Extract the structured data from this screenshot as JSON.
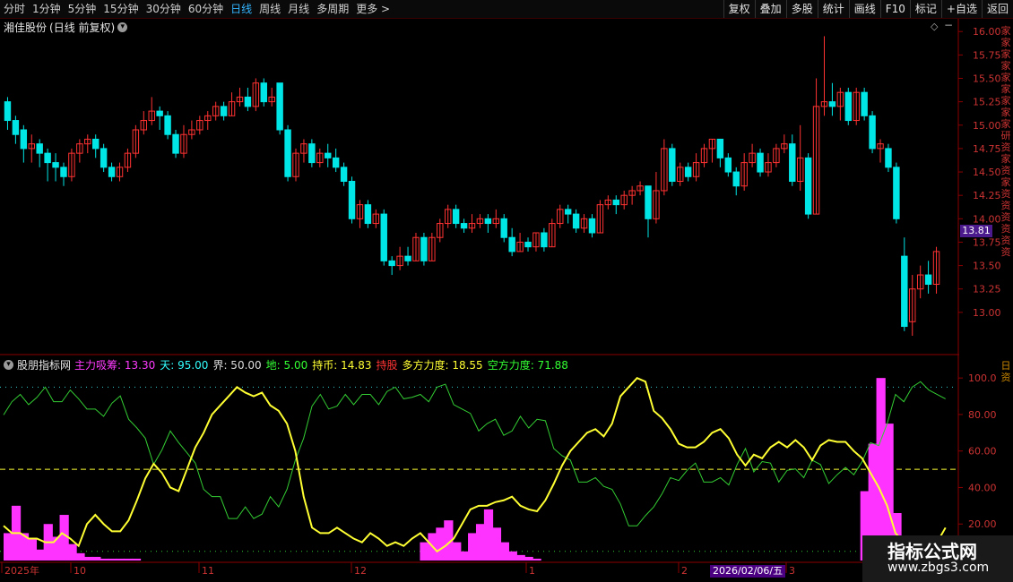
{
  "toolbar": {
    "periods": [
      "分时",
      "1分钟",
      "5分钟",
      "15分钟",
      "30分钟",
      "60分钟",
      "日线",
      "周线",
      "月线",
      "多周期",
      "更多"
    ],
    "active": "日线",
    "more_arrow": ">",
    "actions": [
      "复权",
      "叠加",
      "多股",
      "统计",
      "画线",
      "F10",
      "标记",
      "+自选",
      "返回"
    ]
  },
  "stock": {
    "name": "湘佳股份",
    "mode": "(日线 前复权)"
  },
  "price_axis": {
    "ticks": [
      "16.00",
      "15.75",
      "15.50",
      "15.25",
      "15.00",
      "14.75",
      "14.50",
      "14.25",
      "14.00",
      "13.75",
      "13.50",
      "13.25",
      "13.00"
    ],
    "current": "13.81"
  },
  "indicator": {
    "name": "股朋指标网",
    "items": [
      {
        "label": "主力吸筹:",
        "value": "13.30",
        "color": "#ff3bff"
      },
      {
        "label": "天:",
        "value": "95.00",
        "color": "#33ffff"
      },
      {
        "label": "界:",
        "value": "50.00",
        "color": "#dddddd"
      },
      {
        "label": "地:",
        "value": "5.00",
        "color": "#33ff33"
      },
      {
        "label": "持币:",
        "value": "14.83",
        "color": "#ffff33"
      },
      {
        "label": "持股",
        "value": "",
        "color": "#ff3333"
      },
      {
        "label": "多方力度:",
        "value": "18.55",
        "color": "#ffff33"
      },
      {
        "label": "空方力度:",
        "value": "71.88",
        "color": "#33ff33"
      }
    ],
    "axis_ticks": [
      "100.0",
      "80.00",
      "60.00",
      "40.00",
      "20.00"
    ]
  },
  "time_axis": {
    "labels": [
      "2025年",
      "10",
      "11",
      "12",
      "1",
      "2",
      "3"
    ],
    "cursor_date": "2026/02/06/五"
  },
  "right_side_chars": {
    "top": "家家家家家家家家家研资家资家资资资资资资",
    "bottom": "日资"
  },
  "watermark": {
    "title": "指标公式网",
    "url": "www.zbgs3.com"
  },
  "colors": {
    "up": "#ff3232",
    "down": "#00e5e5",
    "yellow": "#ffff33",
    "green": "#33cc33",
    "magenta": "#ff33ff",
    "border": "#8b0000"
  },
  "chart_data": {
    "type": "candlestick",
    "candles": [
      [
        15.25,
        15.05,
        15.3,
        14.95
      ],
      [
        15.05,
        14.9,
        15.1,
        14.8
      ],
      [
        14.95,
        14.75,
        15.0,
        14.6
      ],
      [
        14.75,
        14.8,
        14.9,
        14.6
      ],
      [
        14.8,
        14.7,
        14.85,
        14.55
      ],
      [
        14.7,
        14.6,
        14.75,
        14.4
      ],
      [
        14.6,
        14.55,
        14.7,
        14.4
      ],
      [
        14.55,
        14.45,
        14.6,
        14.35
      ],
      [
        14.45,
        14.7,
        14.75,
        14.4
      ],
      [
        14.7,
        14.8,
        14.85,
        14.6
      ],
      [
        14.8,
        14.85,
        14.9,
        14.7
      ],
      [
        14.85,
        14.75,
        14.9,
        14.65
      ],
      [
        14.75,
        14.55,
        14.8,
        14.5
      ],
      [
        14.55,
        14.45,
        14.6,
        14.4
      ],
      [
        14.45,
        14.55,
        14.6,
        14.4
      ],
      [
        14.55,
        14.7,
        14.75,
        14.5
      ],
      [
        14.7,
        14.95,
        15.0,
        14.65
      ],
      [
        14.95,
        15.05,
        15.15,
        14.9
      ],
      [
        15.05,
        15.15,
        15.3,
        15.0
      ],
      [
        15.15,
        15.1,
        15.2,
        14.95
      ],
      [
        15.1,
        14.9,
        15.15,
        14.85
      ],
      [
        14.9,
        14.7,
        14.95,
        14.65
      ],
      [
        14.7,
        14.9,
        15.0,
        14.65
      ],
      [
        14.9,
        14.95,
        15.05,
        14.85
      ],
      [
        14.95,
        15.05,
        15.1,
        14.9
      ],
      [
        15.05,
        15.1,
        15.15,
        14.95
      ],
      [
        15.1,
        15.2,
        15.25,
        15.05
      ],
      [
        15.2,
        15.1,
        15.25,
        15.05
      ],
      [
        15.1,
        15.25,
        15.35,
        15.1
      ],
      [
        15.25,
        15.3,
        15.4,
        15.2
      ],
      [
        15.3,
        15.2,
        15.4,
        15.15
      ],
      [
        15.2,
        15.45,
        15.5,
        15.15
      ],
      [
        15.45,
        15.25,
        15.5,
        15.2
      ],
      [
        15.25,
        15.3,
        15.4,
        15.2
      ],
      [
        15.45,
        14.95,
        15.45,
        14.9
      ],
      [
        14.95,
        14.45,
        15.0,
        14.4
      ],
      [
        14.45,
        14.7,
        14.75,
        14.4
      ],
      [
        14.7,
        14.8,
        14.85,
        14.6
      ],
      [
        14.8,
        14.6,
        14.85,
        14.55
      ],
      [
        14.6,
        14.7,
        14.75,
        14.55
      ],
      [
        14.7,
        14.65,
        14.8,
        14.55
      ],
      [
        14.65,
        14.55,
        14.75,
        14.5
      ],
      [
        14.55,
        14.4,
        14.6,
        14.35
      ],
      [
        14.4,
        14.0,
        14.45,
        13.95
      ],
      [
        14.0,
        14.15,
        14.2,
        13.9
      ],
      [
        14.15,
        13.95,
        14.2,
        13.9
      ],
      [
        13.95,
        14.05,
        14.1,
        13.9
      ],
      [
        14.05,
        13.55,
        14.1,
        13.5
      ],
      [
        13.55,
        13.5,
        13.6,
        13.4
      ],
      [
        13.5,
        13.6,
        13.7,
        13.45
      ],
      [
        13.6,
        13.55,
        13.7,
        13.5
      ],
      [
        13.55,
        13.8,
        13.85,
        13.55
      ],
      [
        13.8,
        13.55,
        13.85,
        13.5
      ],
      [
        13.55,
        13.8,
        13.85,
        13.55
      ],
      [
        13.8,
        13.95,
        14.0,
        13.75
      ],
      [
        13.95,
        14.1,
        14.15,
        13.9
      ],
      [
        14.1,
        13.95,
        14.15,
        13.9
      ],
      [
        13.95,
        13.9,
        14.0,
        13.85
      ],
      [
        13.9,
        13.95,
        14.05,
        13.85
      ],
      [
        13.95,
        14.0,
        14.05,
        13.9
      ],
      [
        14.0,
        13.95,
        14.05,
        13.85
      ],
      [
        13.95,
        14.0,
        14.1,
        13.9
      ],
      [
        14.0,
        13.8,
        14.05,
        13.75
      ],
      [
        13.8,
        13.65,
        13.9,
        13.6
      ],
      [
        13.65,
        13.75,
        13.85,
        13.65
      ],
      [
        13.75,
        13.7,
        13.8,
        13.65
      ],
      [
        13.7,
        13.85,
        13.85,
        13.65
      ],
      [
        13.85,
        13.7,
        13.9,
        13.65
      ],
      [
        13.7,
        13.95,
        14.0,
        13.7
      ],
      [
        13.95,
        14.1,
        14.15,
        13.9
      ],
      [
        14.1,
        14.05,
        14.15,
        13.95
      ],
      [
        14.05,
        13.9,
        14.1,
        13.85
      ],
      [
        13.9,
        14.0,
        14.05,
        13.85
      ],
      [
        14.0,
        13.85,
        14.05,
        13.8
      ],
      [
        13.85,
        14.15,
        14.2,
        13.85
      ],
      [
        14.15,
        14.2,
        14.25,
        14.1
      ],
      [
        14.2,
        14.15,
        14.25,
        14.05
      ],
      [
        14.15,
        14.25,
        14.3,
        14.1
      ],
      [
        14.25,
        14.3,
        14.35,
        14.15
      ],
      [
        14.3,
        14.35,
        14.4,
        14.25
      ],
      [
        14.35,
        14.0,
        14.35,
        13.8
      ],
      [
        14.0,
        14.3,
        14.5,
        13.95
      ],
      [
        14.3,
        14.75,
        14.85,
        14.25
      ],
      [
        14.75,
        14.4,
        14.8,
        14.35
      ],
      [
        14.4,
        14.55,
        14.6,
        14.35
      ],
      [
        14.55,
        14.45,
        14.6,
        14.4
      ],
      [
        14.45,
        14.6,
        14.7,
        14.4
      ],
      [
        14.6,
        14.75,
        14.8,
        14.55
      ],
      [
        14.75,
        14.85,
        14.85,
        14.6
      ],
      [
        14.85,
        14.65,
        14.85,
        14.55
      ],
      [
        14.65,
        14.5,
        14.7,
        14.45
      ],
      [
        14.5,
        14.35,
        14.55,
        14.25
      ],
      [
        14.35,
        14.6,
        14.7,
        14.3
      ],
      [
        14.6,
        14.7,
        14.8,
        14.55
      ],
      [
        14.7,
        14.5,
        14.75,
        14.45
      ],
      [
        14.5,
        14.6,
        14.7,
        14.45
      ],
      [
        14.6,
        14.75,
        14.8,
        14.55
      ],
      [
        14.75,
        14.8,
        14.9,
        14.7
      ],
      [
        14.8,
        14.4,
        14.9,
        14.35
      ],
      [
        14.4,
        14.65,
        15.0,
        14.3
      ],
      [
        14.65,
        14.05,
        14.7,
        14.0
      ],
      [
        14.05,
        15.2,
        15.5,
        14.05
      ],
      [
        15.2,
        15.25,
        15.95,
        15.1
      ],
      [
        15.25,
        15.2,
        15.45,
        15.1
      ],
      [
        15.2,
        15.35,
        15.4,
        15.05
      ],
      [
        15.35,
        15.05,
        15.4,
        15.0
      ],
      [
        15.05,
        15.35,
        15.4,
        15.0
      ],
      [
        15.35,
        15.1,
        15.4,
        15.05
      ],
      [
        15.1,
        14.75,
        15.15,
        14.7
      ],
      [
        14.75,
        14.8,
        14.85,
        14.6
      ],
      [
        14.75,
        14.55,
        14.8,
        14.5
      ],
      [
        14.55,
        14.0,
        14.6,
        13.95
      ],
      [
        13.6,
        12.85,
        13.8,
        12.8
      ],
      [
        12.9,
        13.25,
        13.4,
        12.75
      ],
      [
        13.25,
        13.4,
        13.5,
        13.15
      ],
      [
        13.4,
        13.3,
        13.55,
        13.2
      ],
      [
        13.3,
        13.65,
        13.7,
        13.2
      ]
    ],
    "indicator_series": {
      "magenta_bars": [
        15,
        30,
        15,
        12,
        6,
        20,
        13,
        25,
        9,
        4,
        2,
        2,
        1,
        1,
        1,
        1,
        1,
        0,
        0,
        0,
        0,
        0,
        0,
        0,
        0,
        0,
        0,
        0,
        0,
        0,
        0,
        0,
        0,
        0,
        0,
        0,
        0,
        0,
        0,
        0,
        0,
        0,
        0,
        0,
        0,
        0,
        0,
        0,
        0,
        0,
        0,
        0,
        0,
        0,
        0,
        0,
        0,
        0,
        0,
        0,
        0,
        0,
        0,
        0,
        0,
        0,
        0,
        0,
        0,
        0,
        0,
        0,
        0,
        0,
        0,
        0,
        0,
        0,
        0,
        0,
        0,
        0,
        0,
        0,
        0,
        0,
        0,
        0,
        0,
        0,
        0,
        0,
        0,
        0,
        0,
        0,
        0,
        0,
        0,
        0,
        0,
        0,
        0,
        0,
        0,
        0,
        0,
        0,
        0,
        0,
        0,
        0,
        0,
        0,
        0,
        0,
        0,
        0,
        0,
        0,
        0,
        0,
        0,
        0,
        0,
        0,
        0,
        0,
        0,
        0
      ],
      "yellow_line": [
        19,
        15,
        15,
        12,
        12,
        10,
        10,
        15,
        12,
        8,
        20,
        25,
        20,
        16,
        16,
        22,
        33,
        45,
        53,
        48,
        40,
        38,
        50,
        62,
        70,
        80,
        85,
        90,
        95,
        92,
        90,
        92,
        85,
        82,
        75,
        60,
        35,
        18,
        15,
        15,
        18,
        15,
        12,
        10,
        15,
        12,
        8,
        10,
        8,
        12,
        15,
        10,
        5,
        8,
        12,
        20,
        28,
        30,
        30,
        32,
        33,
        35,
        30,
        28,
        27,
        33,
        42,
        52,
        60,
        65,
        70,
        72,
        68,
        75,
        90,
        95,
        100,
        98,
        82,
        78,
        72,
        64,
        62,
        62,
        65,
        70,
        72,
        67,
        58,
        52,
        58,
        56,
        62,
        65,
        62,
        66,
        62,
        55,
        63,
        66,
        65,
        65,
        60,
        56,
        48,
        40,
        30,
        15,
        10,
        5,
        3,
        2,
        10,
        18
      ]
    }
  }
}
